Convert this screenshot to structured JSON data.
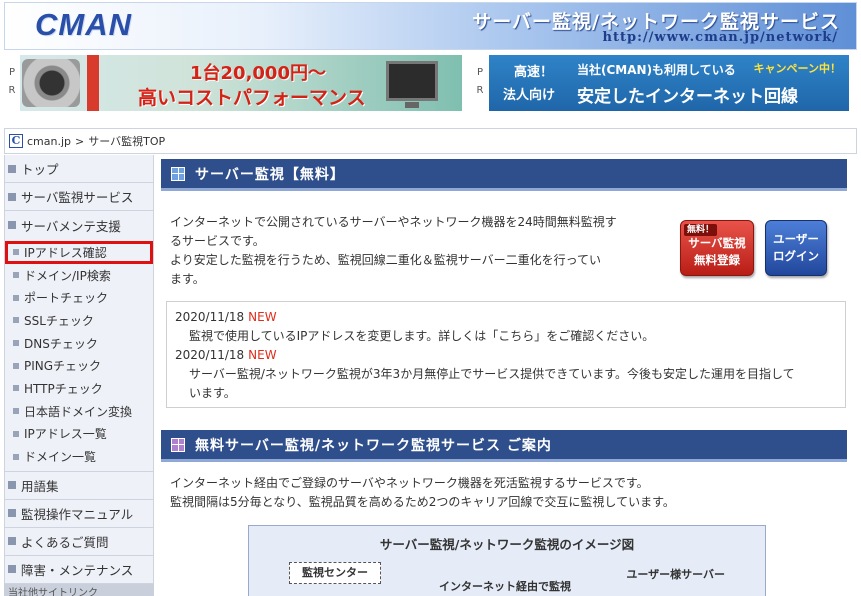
{
  "header": {
    "logo": "CMAN",
    "title": "サーバー監視/ネットワーク監視サービス",
    "url": "http://www.cman.jp/network/"
  },
  "ads": {
    "pr_label_1": "P",
    "pr_label_2": "R",
    "ad1": {
      "line1": "1台20,000円～",
      "line2": "高いコストパフォーマンス"
    },
    "ad2": {
      "a": "高速！",
      "b": "法人向け",
      "c": "当社(CMAN)も利用している",
      "d": "安定したインターネット回線",
      "campaign": "キャンペーン中！"
    }
  },
  "breadcrumb": {
    "icon": "C",
    "home": "cman.jp",
    "sep": ">",
    "current": "サーバ監視TOP"
  },
  "sidebar": {
    "main_items": [
      {
        "label": "トップ"
      },
      {
        "label": "サーバ監視サービス"
      },
      {
        "label": "サーバメンテ支援"
      }
    ],
    "sub_items": [
      {
        "label": "IPアドレス確認"
      },
      {
        "label": "ドメイン/IP検索"
      },
      {
        "label": "ポートチェック"
      },
      {
        "label": "SSLチェック"
      },
      {
        "label": "DNSチェック"
      },
      {
        "label": "PINGチェック"
      },
      {
        "label": "HTTPチェック"
      },
      {
        "label": "日本語ドメイン変換"
      },
      {
        "label": "IPアドレス一覧"
      },
      {
        "label": "ドメイン一覧"
      }
    ],
    "bottom_items": [
      {
        "label": "用語集"
      },
      {
        "label": "監視操作マニュアル"
      },
      {
        "label": "よくあるご質問"
      },
      {
        "label": "障害・メンテナンス"
      }
    ],
    "cutoff": "当社他サイトリンク"
  },
  "main": {
    "section1_title": "サーバー監視【無料】",
    "intro_lines": [
      "インターネットで公開されているサーバーやネットワーク機器を24時間無料監視す",
      "るサービスです。",
      "より安定した監視を行うため、監視回線二重化＆監視サーバー二重化を行ってい",
      "ます。"
    ],
    "register_button": {
      "tag": "無料！",
      "line1": "サーバ監視",
      "line2": "無料登録"
    },
    "login_button": {
      "line1": "ユーザー",
      "line2": "ログイン"
    },
    "news": [
      {
        "date": "2020/11/18",
        "badge": "NEW",
        "body": "監視で使用しているIPアドレスを変更します。詳しくは「こちら」をご確認ください。"
      },
      {
        "date": "2020/11/18",
        "badge": "NEW",
        "body_l1": "サーバー監視/ネットワーク監視が3年3か月無停止でサービス提供できています。今後も安定した運用を目指して",
        "body_l2": "います。"
      }
    ],
    "section2_title": "無料サーバー監視/ネットワーク監視サービス ご案内",
    "intro2_lines": [
      "インターネット経由でご登録のサーバやネットワーク機器を死活監視するサービスです。",
      "監視間隔は5分毎となり、監視品質を高めるため2つのキャリア回線で交互に監視しています。"
    ],
    "diagram": {
      "title": "サーバー監視/ネットワーク監視のイメージ図",
      "center": "監視センター",
      "inet": "インターネット経由で監視",
      "user": "ユーザー様サーバー"
    }
  },
  "colors": {
    "section_bg": "#2f4e8c",
    "new_badge": "#e02c1a",
    "highlight": "#e01010"
  }
}
